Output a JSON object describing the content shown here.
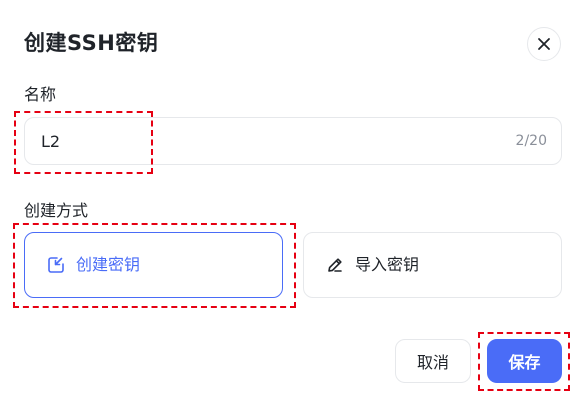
{
  "dialog": {
    "title": "创建SSH密钥",
    "close_icon": "close-icon"
  },
  "name_field": {
    "label": "名称",
    "value": "L2",
    "placeholder": "",
    "char_count": "2/20"
  },
  "method": {
    "label": "创建方式",
    "options": [
      {
        "label": "创建密钥",
        "icon": "create-key-icon",
        "selected": true
      },
      {
        "label": "导入密钥",
        "icon": "pencil-icon",
        "selected": false
      }
    ]
  },
  "footer": {
    "cancel_label": "取消",
    "save_label": "保存"
  },
  "colors": {
    "accent": "#4a6cf7",
    "highlight": "#e60012",
    "border": "#e6e8eb"
  }
}
